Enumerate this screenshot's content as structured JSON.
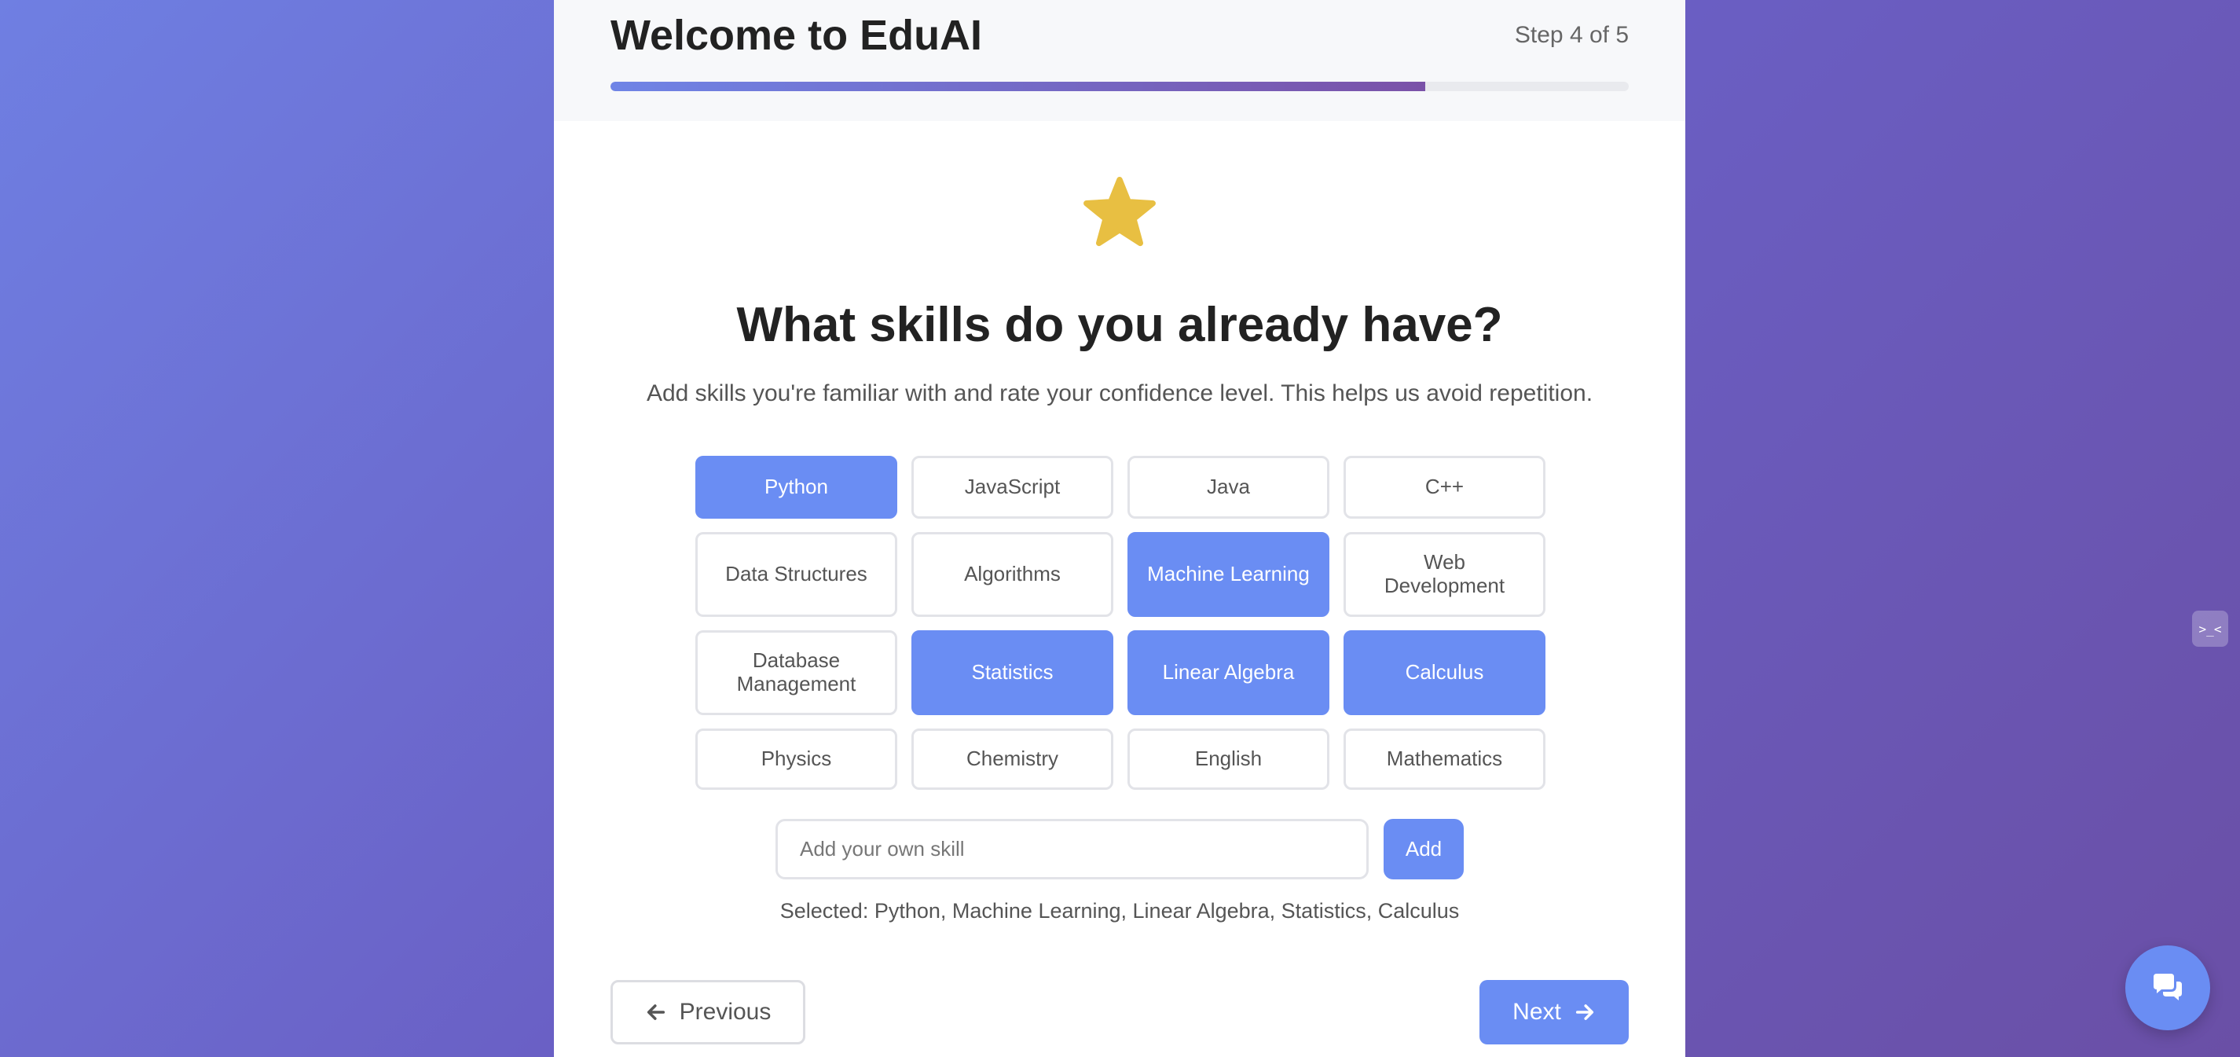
{
  "header": {
    "title": "Welcome to EduAI",
    "step_text": "Step 4 of 5",
    "progress_fraction": 0.8
  },
  "main": {
    "icon": "star-icon",
    "heading": "What skills do you already have?",
    "subtitle": "Add skills you're familiar with and rate your confidence level. This helps us avoid repetition.",
    "skills": [
      {
        "label": "Python",
        "selected": true
      },
      {
        "label": "JavaScript",
        "selected": false
      },
      {
        "label": "Java",
        "selected": false
      },
      {
        "label": "C++",
        "selected": false
      },
      {
        "label": "Data Structures",
        "selected": false
      },
      {
        "label": "Algorithms",
        "selected": false
      },
      {
        "label": "Machine Learning",
        "selected": true
      },
      {
        "label": "Web Development",
        "selected": false
      },
      {
        "label": "Database Management",
        "selected": false
      },
      {
        "label": "Statistics",
        "selected": true
      },
      {
        "label": "Linear Algebra",
        "selected": true
      },
      {
        "label": "Calculus",
        "selected": true
      },
      {
        "label": "Physics",
        "selected": false
      },
      {
        "label": "Chemistry",
        "selected": false
      },
      {
        "label": "English",
        "selected": false
      },
      {
        "label": "Mathematics",
        "selected": false
      }
    ],
    "custom_skill": {
      "placeholder": "Add your own skill",
      "value": "",
      "add_label": "Add"
    },
    "selected_summary": "Selected: Python, Machine Learning, Linear Algebra, Statistics, Calculus"
  },
  "nav": {
    "previous_label": "Previous",
    "next_label": "Next"
  },
  "colors": {
    "accent": "#6a8df3",
    "star": "#e8bf42",
    "gradient_start": "#6f7fe2",
    "gradient_end": "#6a4fa6"
  },
  "side_tab": {
    "label": ">_<",
    "icon": "side-panel-icon"
  },
  "chat": {
    "icon": "chat-bubbles-icon"
  }
}
